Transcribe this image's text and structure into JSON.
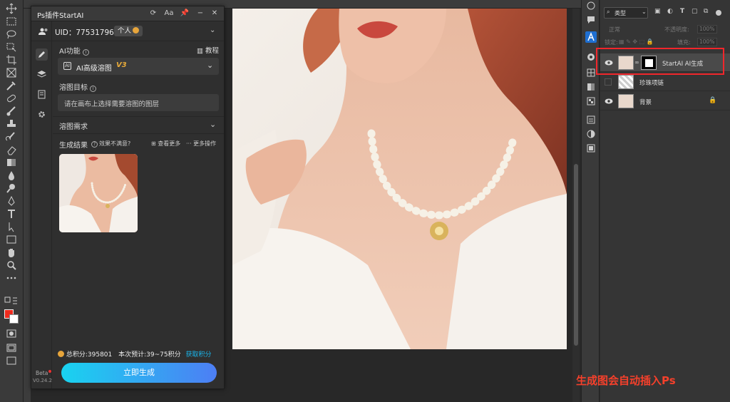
{
  "plugin": {
    "title": "Ps插件StartAI",
    "uid_label": "UID：775317965",
    "account_badge": "个人",
    "ai_function_label": "AI功能",
    "tutorial_label": "教程",
    "ai_mode": "AI高级溶图",
    "ai_mode_version": "V3",
    "target_label": "溶图目标",
    "target_hint": "请在画布上选择需要溶图的图层",
    "requirement_label": "溶图需求",
    "result_label": "生成结果",
    "unsatisfied_label": "效果不满意?",
    "view_more_label": "查看更多",
    "more_ops_label": "更多操作",
    "total_points": "总积分:395801",
    "estimate_points": "本次预计:39~75积分",
    "get_points_label": "获取积分",
    "generate_button": "立即生成",
    "beta_label": "Beta",
    "version": "V0.24.2",
    "coin_color": "#e7a53b",
    "accent_color": "#19d3f0"
  },
  "layers": {
    "filter_label": "类型",
    "blend_mode": "正常",
    "opacity_label": "不透明度:",
    "opacity_value": "100%",
    "lock_label": "锁定:",
    "fill_label": "填充:",
    "fill_value": "100%",
    "items": [
      {
        "name": "StartAI AI生成",
        "visible": true
      },
      {
        "name": "珍珠项链",
        "visible": false
      },
      {
        "name": "背景",
        "visible": true
      }
    ]
  },
  "annotation": "生成图会自动插入Ps",
  "colors": {
    "foreground": "#ee2a1d",
    "background": "#ffffff",
    "highlight": "#f1262b"
  }
}
